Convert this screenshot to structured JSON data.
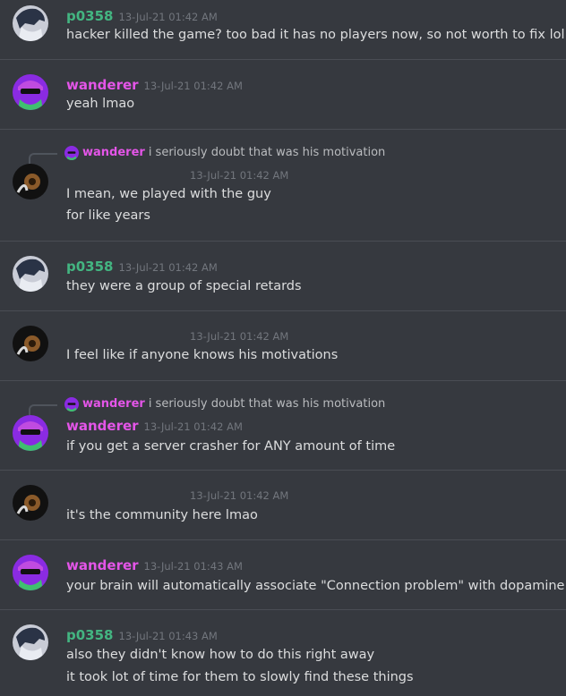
{
  "colors": {
    "background": "#36393f",
    "user_green": "#43b581",
    "user_pink": "#e455e8",
    "timestamp": "#72767d",
    "text": "#dcddde"
  },
  "messages": [
    {
      "user": "p0358",
      "time": "13-Jul-21 01:42 AM",
      "lines": [
        "hacker killed the game? too bad it has no players now, so not worth to fix lol"
      ]
    },
    {
      "user": "wanderer",
      "time": "13-Jul-21 01:42 AM",
      "lines": [
        "yeah lmao"
      ]
    },
    {
      "reply_user": "wanderer",
      "reply_text": "i seriously doubt that was his motivation",
      "time": "13-Jul-21 01:42 AM",
      "lines": [
        "I mean, we played with the guy",
        "for like years"
      ]
    },
    {
      "user": "p0358",
      "time": "13-Jul-21 01:42 AM",
      "lines": [
        "they were a group of special retards"
      ]
    },
    {
      "time": "13-Jul-21 01:42 AM",
      "lines": [
        "I feel like if anyone knows his motivations"
      ]
    },
    {
      "reply_user": "wanderer",
      "reply_text": "i seriously doubt that was his motivation",
      "user": "wanderer",
      "time": "13-Jul-21 01:42 AM",
      "lines": [
        "if you get a server crasher for ANY amount of time"
      ]
    },
    {
      "time": "13-Jul-21 01:42 AM",
      "lines": [
        "it's the community here lmao"
      ]
    },
    {
      "user": "wanderer",
      "time": "13-Jul-21 01:43 AM",
      "lines": [
        "your brain will automatically associate \"Connection problem\" with dopamine"
      ]
    },
    {
      "user": "p0358",
      "time": "13-Jul-21 01:43 AM",
      "lines": [
        "also they didn't know how to do this right away",
        "it took lot of time for them to slowly find these things"
      ]
    }
  ]
}
